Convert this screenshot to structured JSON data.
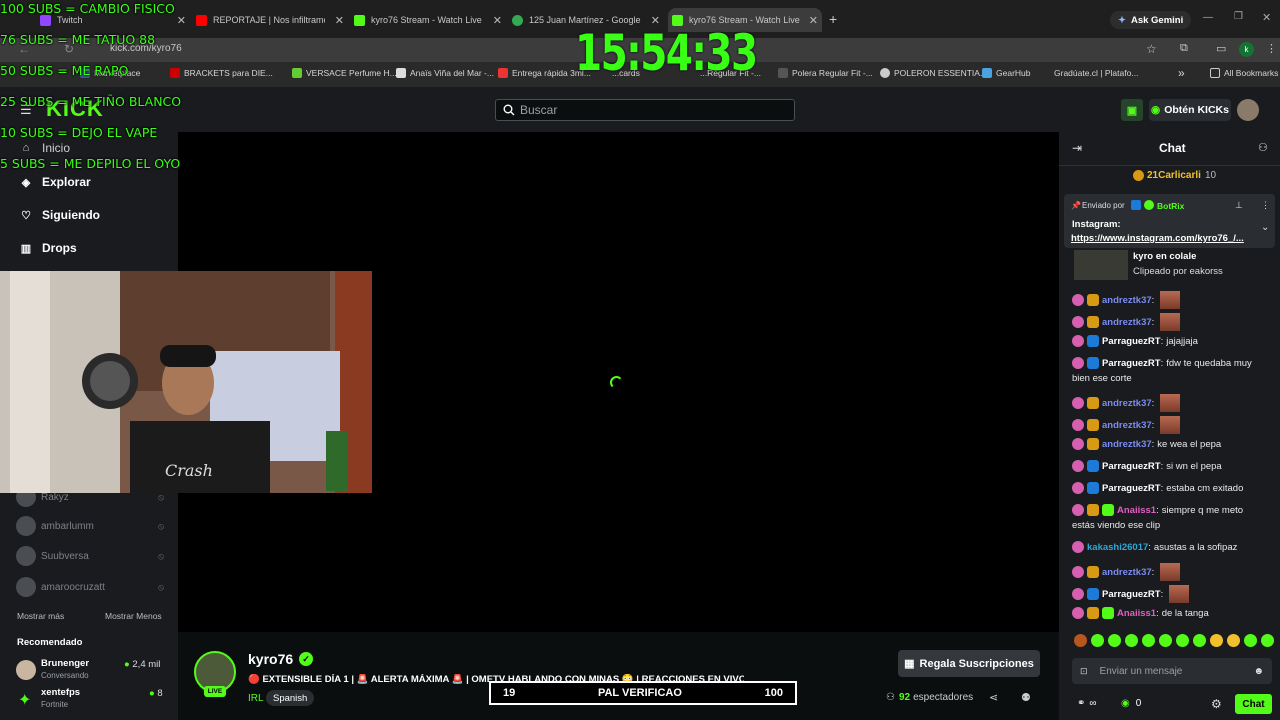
{
  "browser": {
    "tabs": [
      {
        "title": "Twitch",
        "color": "#9146ff"
      },
      {
        "title": "REPORTAJE | Nos infiltramos en",
        "color": "#ff0000"
      },
      {
        "title": "kyro76 Stream - Watch Live on",
        "color": "#53fc18"
      },
      {
        "title": "125 Juan Martínez - Google Ma",
        "color": "#34a853"
      },
      {
        "title": "kyro76 Stream - Watch Live on",
        "color": "#53fc18"
      }
    ],
    "new_tab": "+",
    "gemini": "Ask Gemini",
    "url": "kick.com/kyro76",
    "bookmarks": [
      "Marketplace",
      "BRACKETS para DIE...",
      "VERSACE Perfume H...",
      "Anaïs Viña del Mar -...",
      "Entrega rápida 3ml...",
      "...cards",
      "...Regular Fit -...",
      "Polera Regular Fit -...",
      "POLERON ESSENTIA...",
      "GearHub",
      "Gradúate.cl | Platafo..."
    ],
    "more": "»",
    "all_bookmarks": "All Bookmarks"
  },
  "overlay": {
    "goals": [
      "100 SUBS = CAMBIO FISICO",
      "76 SUBS = ME TATUO 88",
      "50 SUBS = ME RAPO",
      "25 SUBS = ME TIÑO BLANCO",
      "10 SUBS = DEJO EL VAPE",
      "5 SUBS = ME DEPILO EL OYO"
    ],
    "clock": "15:54:33",
    "goal_bar": {
      "left": "19",
      "label": "PAL VERIFICAO",
      "right": "100"
    }
  },
  "kick": {
    "logo": "KICK",
    "search_placeholder": "Buscar",
    "get_kicks": "Obtén KICKs",
    "nav": {
      "home": "Inicio",
      "browse": "Explorar",
      "following": "Siguiendo",
      "drops": "Drops"
    },
    "following_channels": [
      "Rakyz",
      "ambarlumm",
      "Suubversa",
      "amaroocruzatt"
    ],
    "show_more": "Mostrar más",
    "show_less": "Mostrar Menos",
    "recommended_title": "Recomendado",
    "recommended": [
      {
        "name": "Brunenger",
        "category": "Conversando",
        "viewers": "2,4 mil"
      },
      {
        "name": "xentefps",
        "category": "Fortnite",
        "viewers": "8"
      }
    ]
  },
  "stream": {
    "channel": "kyro76",
    "live_badge": "LIVE",
    "title": "🔴 EXTENSIBLE DÍA 1 | 🚨 ALERTA MÁXIMA 🚨 | OMETV HABLANDO CON MINAS 😳 | REACCIONES EN VIVO",
    "category": "IRL",
    "language": "Spanish",
    "gift_subs": "Regala Suscripciones",
    "viewers": "92",
    "viewers_label": "espectadores"
  },
  "chat": {
    "title": "Chat",
    "top_gifter": {
      "name": "21Carlicarli",
      "count": "10"
    },
    "pinned": {
      "sent_by": "Enviado por",
      "bot": "BotRix",
      "label": "Instagram:",
      "link": "https://www.instagram.com/kyro76_/..."
    },
    "clip": {
      "title": "kyro en colale",
      "by": "Clipeado por eakorss"
    },
    "messages": [
      {
        "user": "andreztk37",
        "text": "",
        "emote": true,
        "color": "#7b8cf0",
        "badges": [
          "b-pink",
          "b-gold"
        ]
      },
      {
        "user": "andreztk37",
        "text": "",
        "emote": true,
        "color": "#7b8cf0",
        "badges": [
          "b-pink",
          "b-gold"
        ]
      },
      {
        "user": "ParraguezRT",
        "text": "jajajjaja",
        "emote": false,
        "color": "#ffffff",
        "badges": [
          "b-pink",
          "b-blue"
        ]
      },
      {
        "user": "ParraguezRT",
        "text": "fdw te quedaba muy",
        "emote": false,
        "color": "#ffffff",
        "badges": [
          "b-pink",
          "b-blue"
        ]
      },
      {
        "user": "",
        "text": "bien ese corte",
        "emote": false,
        "color": "#ffffff",
        "badges": []
      },
      {
        "user": "andreztk37",
        "text": "",
        "emote": true,
        "color": "#7b8cf0",
        "badges": [
          "b-pink",
          "b-gold"
        ]
      },
      {
        "user": "andreztk37",
        "text": "",
        "emote": true,
        "color": "#7b8cf0",
        "badges": [
          "b-pink",
          "b-gold"
        ]
      },
      {
        "user": "andreztk37",
        "text": "ke wea el pepa",
        "emote": false,
        "color": "#7b8cf0",
        "badges": [
          "b-pink",
          "b-gold"
        ]
      },
      {
        "user": "ParraguezRT",
        "text": "si wn el pepa",
        "emote": false,
        "color": "#ffffff",
        "badges": [
          "b-pink",
          "b-blue"
        ]
      },
      {
        "user": "ParraguezRT",
        "text": "estaba cm exitado",
        "emote": false,
        "color": "#ffffff",
        "badges": [
          "b-pink",
          "b-blue"
        ]
      },
      {
        "user": "Anaiiss1",
        "text": "siempre q me meto",
        "emote": false,
        "color": "#e05fc4",
        "badges": [
          "b-pink",
          "b-gold",
          "b-green"
        ]
      },
      {
        "user": "",
        "text": "estás viendo ese clip",
        "emote": false,
        "color": "#ffffff",
        "badges": []
      },
      {
        "user": "kakashi26017",
        "text": "asustas a la sofipaz",
        "emote": false,
        "color": "#2fa7d8",
        "badges": [
          "b-pink"
        ]
      },
      {
        "user": "andreztk37",
        "text": "",
        "emote": true,
        "color": "#7b8cf0",
        "badges": [
          "b-pink",
          "b-gold"
        ]
      },
      {
        "user": "ParraguezRT",
        "text": "",
        "emote": true,
        "color": "#ffffff",
        "badges": [
          "b-pink",
          "b-blue"
        ]
      },
      {
        "user": "Anaiiss1",
        "text": "de la tanga",
        "emote": false,
        "color": "#e05fc4",
        "badges": [
          "b-pink",
          "b-gold",
          "b-green"
        ]
      }
    ],
    "input_placeholder": "Enviar un mensaje",
    "points": "0",
    "infinity": "∞",
    "send": "Chat"
  }
}
